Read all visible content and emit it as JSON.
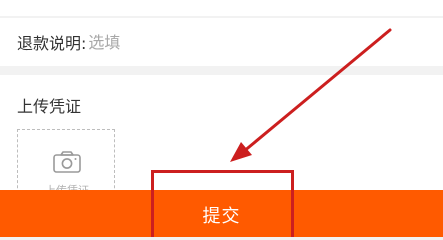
{
  "refund": {
    "label": "退款说明:",
    "placeholder": "选填"
  },
  "upload": {
    "title": "上传凭证",
    "box_label": "上传凭证",
    "icon": "camera-icon"
  },
  "submit": {
    "label": "提交"
  },
  "colors": {
    "accent": "#ff5a00",
    "annotation": "#cc1f1f"
  }
}
